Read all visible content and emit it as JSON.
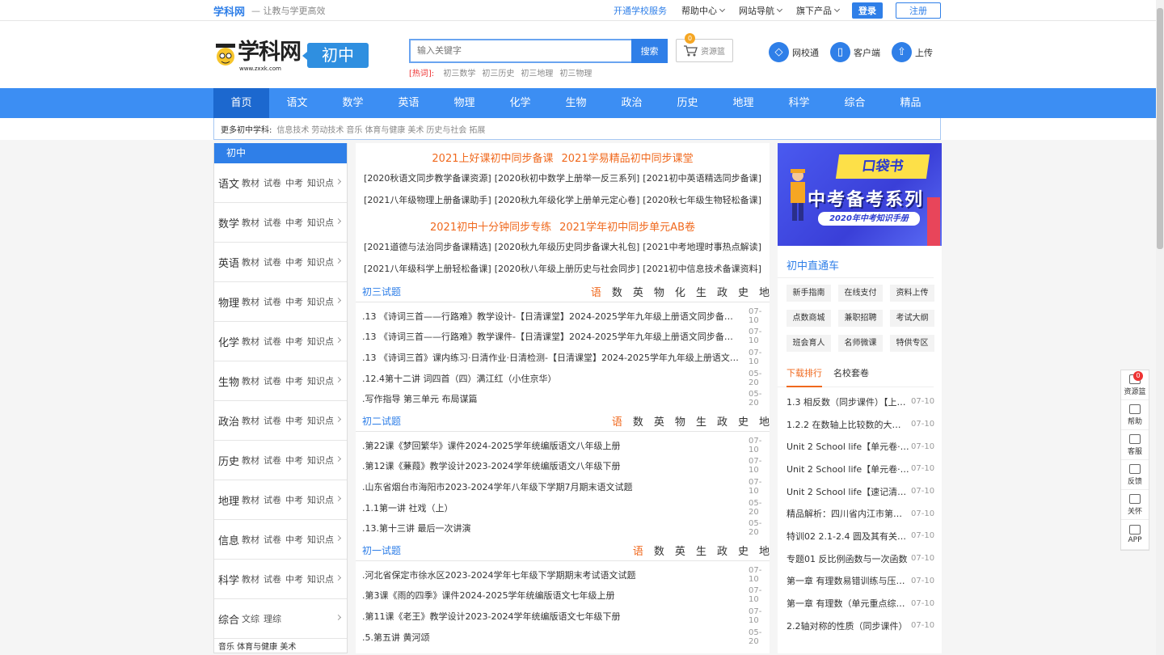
{
  "topbar": {
    "brand": "学科网",
    "slogan": "— 让教与学更高效",
    "links": [
      {
        "label": "开通学校服务",
        "blue": true
      },
      {
        "label": "帮助中心",
        "dropdown": true
      },
      {
        "label": "网站导航",
        "dropdown": true
      },
      {
        "label": "旗下产品",
        "dropdown": true
      }
    ],
    "login": "登录",
    "register": "注册"
  },
  "header": {
    "logo_text": "学科网",
    "logo_url": "www.zxxk.com",
    "level": "初中",
    "search_placeholder": "输入关键字",
    "search_button": "搜索",
    "hot_label": "[热词]:",
    "hot_words": [
      "初三数学",
      "初三历史",
      "初三地理",
      "初三物理"
    ],
    "basket_label": "资源篮",
    "basket_count": "0",
    "icons": [
      {
        "label": "网校通",
        "icon": "diamond-icon",
        "glyph": "◇"
      },
      {
        "label": "客户端",
        "icon": "phone-icon",
        "glyph": "▯"
      },
      {
        "label": "上传",
        "icon": "upload-icon",
        "glyph": "⇧"
      }
    ]
  },
  "nav": {
    "items": [
      "首页",
      "语文",
      "数学",
      "英语",
      "物理",
      "化学",
      "生物",
      "政治",
      "历史",
      "地理",
      "科学",
      "综合",
      "精品"
    ]
  },
  "more_subjects": {
    "label": "更多初中学科:",
    "items": [
      "信息技术",
      "劳动技术",
      "音乐",
      "体育与健康",
      "美术",
      "历史与社会",
      "拓展"
    ]
  },
  "left": {
    "title": "初中",
    "subjects": [
      {
        "name": "语文",
        "links": [
          "教材",
          "试卷",
          "中考",
          "知识点"
        ]
      },
      {
        "name": "数学",
        "links": [
          "教材",
          "试卷",
          "中考",
          "知识点"
        ]
      },
      {
        "name": "英语",
        "links": [
          "教材",
          "试卷",
          "中考",
          "知识点"
        ]
      },
      {
        "name": "物理",
        "links": [
          "教材",
          "试卷",
          "中考",
          "知识点"
        ]
      },
      {
        "name": "化学",
        "links": [
          "教材",
          "试卷",
          "中考",
          "知识点"
        ]
      },
      {
        "name": "生物",
        "links": [
          "教材",
          "试卷",
          "中考",
          "知识点"
        ]
      },
      {
        "name": "政治",
        "links": [
          "教材",
          "试卷",
          "中考",
          "知识点"
        ]
      },
      {
        "name": "历史",
        "links": [
          "教材",
          "试卷",
          "中考",
          "知识点"
        ]
      },
      {
        "name": "地理",
        "links": [
          "教材",
          "试卷",
          "中考",
          "知识点"
        ]
      },
      {
        "name": "信息",
        "links": [
          "教材",
          "试卷",
          "中考",
          "知识点"
        ]
      },
      {
        "name": "科学",
        "links": [
          "教材",
          "试卷",
          "中考",
          "知识点"
        ]
      },
      {
        "name": "综合",
        "links": [
          "文综",
          "理综"
        ]
      }
    ],
    "last_line": "音乐 体育与健康 美术"
  },
  "center": {
    "promo1": [
      "2021上好课初中同步备课",
      "2021学易精品初中同步课堂"
    ],
    "row1": [
      "[2020秋语文同步教学备课资源]",
      "[2020秋初中数学上册举一反三系列]",
      "[2021初中英语精选同步备课]"
    ],
    "row2": [
      "[2021八年级物理上册备课助手]",
      "[2020秋九年级化学上册单元定心卷]",
      "[2020秋七年级生物轻松备课]"
    ],
    "promo2": [
      "2021初中十分钟同步专练",
      "2021学年初中同步单元AB卷"
    ],
    "row3": [
      "[2021道德与法治同步备课精选]",
      "[2020秋九年级历史同步备课大礼包]",
      "[2021中考地理时事热点解读]"
    ],
    "row4": [
      "[2021八年级科学上册轻松备课]",
      "[2020秋八年级上册历史与社会同步]",
      "[2021初中信息技术备课资料]"
    ],
    "sections": [
      {
        "title": "初三试题",
        "tabs": [
          "语",
          "数",
          "英",
          "物",
          "化",
          "生",
          "政",
          "史",
          "地"
        ],
        "rows": [
          {
            "title": ".13 《诗词三首——行路难》教学设计-【日清课堂】2024-2025学年九年级上册语文同步备课（部编版）",
            "date": "07-10"
          },
          {
            "title": ".13 《诗词三首——行路难》教学课件-【日清课堂】2024-2025学年九年级上册语文同步备课（部编版）",
            "date": "07-10"
          },
          {
            "title": ".13 《诗词三首》课内练习·日清作业·日清检测-【日清课堂】2024-2025学年九年级上册语文同步备课",
            "date": "07-10"
          },
          {
            "title": ".12.4第十二讲 词四首（四）满江红（小住京华）",
            "date": "05-20"
          },
          {
            "title": ".写作指导 第三单元 布局谋篇",
            "date": "05-20"
          }
        ]
      },
      {
        "title": "初二试题",
        "tabs": [
          "语",
          "数",
          "英",
          "物",
          "生",
          "政",
          "史",
          "地"
        ],
        "rows": [
          {
            "title": ".第22课《梦回繁华》课件2024-2025学年统编版语文八年级上册",
            "date": "07-10"
          },
          {
            "title": ".第12课《蒹葭》教学设计2023-2024学年统编版语文八年级下册",
            "date": "07-10"
          },
          {
            "title": ".山东省烟台市海阳市2023-2024学年八年级下学期7月期末语文试题",
            "date": "07-10"
          },
          {
            "title": ".1.1第一讲 社戏（上）",
            "date": "05-20"
          },
          {
            "title": ".13.第十三讲 最后一次讲演",
            "date": "05-20"
          }
        ]
      },
      {
        "title": "初一试题",
        "tabs": [
          "语",
          "数",
          "英",
          "生",
          "政",
          "史",
          "地"
        ],
        "rows": [
          {
            "title": ".河北省保定市徐水区2023-2024学年七年级下学期期末考试语文试题",
            "date": "07-10"
          },
          {
            "title": ".第3课《雨的四季》课件2024-2025学年统编版语文七年级上册",
            "date": "07-10"
          },
          {
            "title": ".第11课《老王》教学设计2023-2024学年统编版语文七年级下册",
            "date": "07-10"
          },
          {
            "title": ".5.第五讲 黄河颂",
            "date": "05-20"
          }
        ]
      }
    ]
  },
  "right": {
    "banner": {
      "tag": "口袋书",
      "headline": "中考备考系列",
      "sub": "2020年中考知识手册"
    },
    "direct_title": "初中直通车",
    "tags": [
      "新手指南",
      "在线支付",
      "资料上传",
      "点数商城",
      "兼职招聘",
      "考试大纲",
      "班会育人",
      "名师微课",
      "特供专区"
    ],
    "rank_tabs": [
      "下载排行",
      "名校套卷"
    ],
    "rank": [
      {
        "title": "1.3 相反数（同步课件）【上好课】",
        "date": "07-10"
      },
      {
        "title": "1.2.2 在数轴上比较数的大小（同步课件）",
        "date": "07-10"
      },
      {
        "title": "Unit 2 School life【单元卷·测试卷】",
        "date": "07-10"
      },
      {
        "title": "Unit 2 School life【单元卷·考点卷】",
        "date": "07-10"
      },
      {
        "title": "Unit 2 School life【速记清单】",
        "date": "07-10"
      },
      {
        "title": "精品解析：四川省内江市第一中学",
        "date": "07-10"
      },
      {
        "title": "特训02 2.1-2.4 圆及其有关性质",
        "date": "07-10"
      },
      {
        "title": "专题01 反比例函数与一次函数",
        "date": "07-10"
      },
      {
        "title": "第一章 有理数易错训练与压轴题",
        "date": "07-10"
      },
      {
        "title": "第一章 有理数（单元重点综合测试）",
        "date": "07-10"
      },
      {
        "title": "2.2轴对称的性质（同步课件）",
        "date": "07-10"
      }
    ]
  },
  "sidebar": {
    "items": [
      {
        "label": "资源篮",
        "icon": "basket-icon",
        "badge": "0"
      },
      {
        "label": "帮助",
        "icon": "help-icon"
      },
      {
        "label": "客服",
        "icon": "headset-icon"
      },
      {
        "label": "反馈",
        "icon": "feedback-icon"
      },
      {
        "label": "关怀",
        "icon": "care-icon"
      },
      {
        "label": "APP",
        "icon": "app-icon"
      }
    ]
  },
  "colors": {
    "accent": "#2f7fe8",
    "nav": "#3c8ef3",
    "orange": "#f0691e"
  }
}
